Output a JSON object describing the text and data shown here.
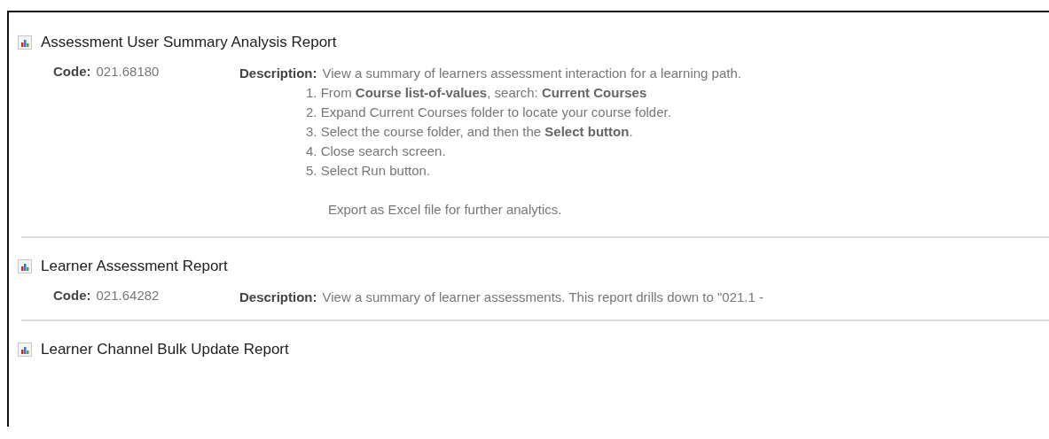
{
  "reports": [
    {
      "title": "Assessment User Summary Analysis Report",
      "code_label": "Code:",
      "code": "021.68180",
      "description_label": "Description:",
      "description": "View a summary of learners assessment interaction for a learning path.",
      "steps": [
        "1. From **Course list-of-values**, search: **Current Courses**",
        "2. Expand Current Courses folder to locate your course folder.",
        "3. Select the course folder, and then the **Select button**.",
        "4. Close search screen.",
        "5. Select Run button."
      ],
      "note": "Export as Excel file for further analytics."
    },
    {
      "title": "Learner Assessment Report",
      "code_label": "Code:",
      "code": "021.64282",
      "description_label": "Description:",
      "description": "View a summary of learner assessments. This report drills down to \"021.1 -"
    },
    {
      "title": "Learner Channel Bulk Update Report"
    }
  ]
}
